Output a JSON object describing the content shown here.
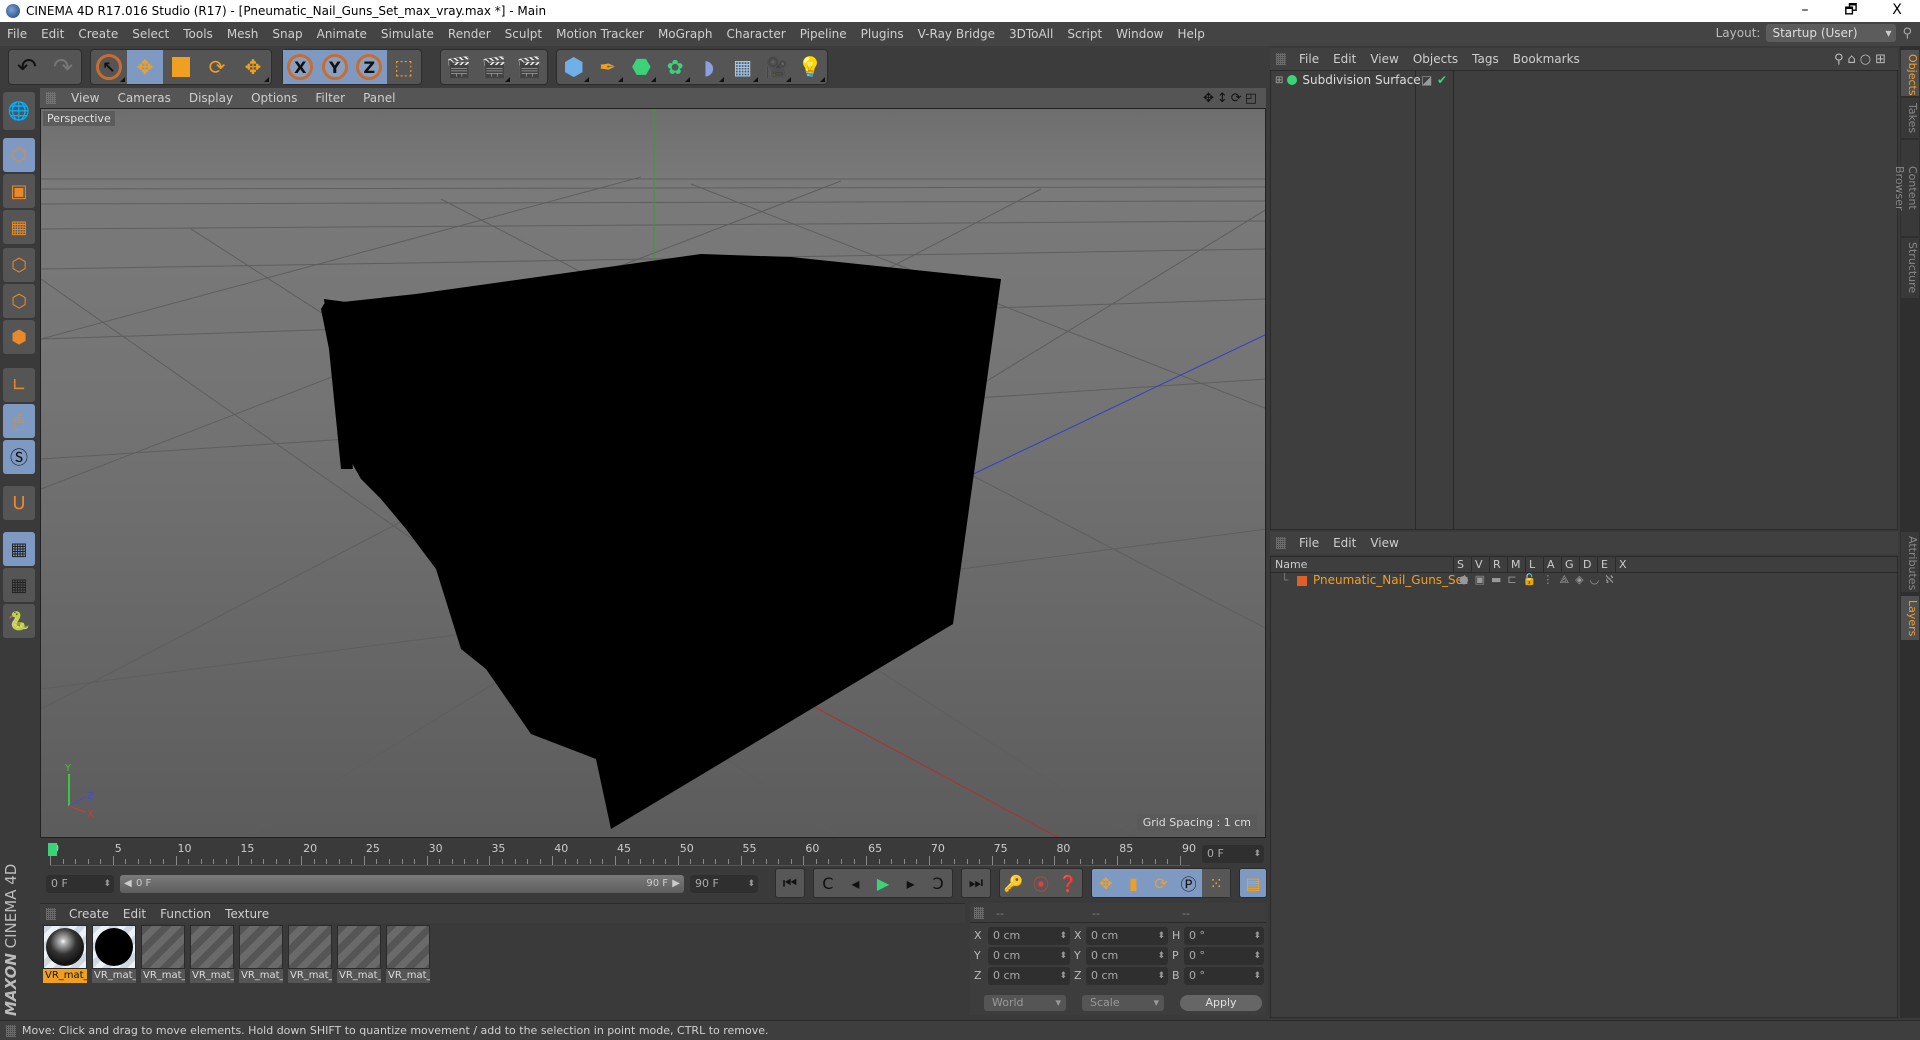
{
  "window": {
    "title": "CINEMA 4D R17.016 Studio (R17) - [Pneumatic_Nail_Guns_Set_max_vray.max *] - Main",
    "minimize": "–",
    "restore": "🗗",
    "close": "X"
  },
  "menubar": {
    "items": [
      "File",
      "Edit",
      "Create",
      "Select",
      "Tools",
      "Mesh",
      "Snap",
      "Animate",
      "Simulate",
      "Render",
      "Sculpt",
      "Motion Tracker",
      "MoGraph",
      "Character",
      "Pipeline",
      "Plugins",
      "V-Ray Bridge",
      "3DToAll",
      "Script",
      "Window",
      "Help"
    ],
    "layout_label": "Layout:",
    "layout_value": "Startup (User)"
  },
  "toolbar": {
    "undo": "↶",
    "redo": "↷",
    "x_axis": "X",
    "y_axis": "Y",
    "z_axis": "Z"
  },
  "viewport": {
    "menu": [
      "View",
      "Cameras",
      "Display",
      "Options",
      "Filter",
      "Panel"
    ],
    "camera_label": "Perspective",
    "grid_spacing": "Grid Spacing : 1 cm",
    "axis_labels": {
      "y": "Y",
      "z": "Z",
      "x": "X"
    }
  },
  "timeline": {
    "ticks": [
      "0",
      "5",
      "10",
      "15",
      "20",
      "25",
      "30",
      "35",
      "40",
      "45",
      "50",
      "55",
      "60",
      "65",
      "70",
      "75",
      "80",
      "85",
      "90"
    ],
    "current_frame": "0 F",
    "start_field": "0 F",
    "range_start": "0 F",
    "range_end": "90 F",
    "end_field": "90 F"
  },
  "materials": {
    "menu": [
      "Create",
      "Edit",
      "Function",
      "Texture"
    ],
    "items": [
      {
        "name": "VR_mat_",
        "type": "chrome",
        "selected": true
      },
      {
        "name": "VR_mat_",
        "type": "black",
        "selected": false
      },
      {
        "name": "VR_mat_",
        "type": "empty",
        "selected": false
      },
      {
        "name": "VR_mat_",
        "type": "empty",
        "selected": false
      },
      {
        "name": "VR_mat_",
        "type": "empty",
        "selected": false
      },
      {
        "name": "VR_mat_",
        "type": "empty",
        "selected": false
      },
      {
        "name": "VR_mat_",
        "type": "empty",
        "selected": false
      },
      {
        "name": "VR_mat_",
        "type": "empty",
        "selected": false
      }
    ]
  },
  "brand": {
    "maxon": "MAXON",
    "product": "CINEMA 4D"
  },
  "coordinates": {
    "headers": [
      "--",
      "--",
      "--"
    ],
    "rows": [
      {
        "a": "X",
        "av": "0 cm",
        "b": "X",
        "bv": "0 cm",
        "c": "H",
        "cv": "0 °"
      },
      {
        "a": "Y",
        "av": "0 cm",
        "b": "Y",
        "bv": "0 cm",
        "c": "P",
        "cv": "0 °"
      },
      {
        "a": "Z",
        "av": "0 cm",
        "b": "Z",
        "bv": "0 cm",
        "c": "B",
        "cv": "0 °"
      }
    ],
    "space": "World",
    "mode": "Scale",
    "apply": "Apply"
  },
  "objects_panel": {
    "menu": [
      "File",
      "Edit",
      "View",
      "Objects",
      "Tags",
      "Bookmarks"
    ],
    "items": [
      {
        "name": "Subdivision Surface"
      }
    ]
  },
  "layers_panel": {
    "menu": [
      "File",
      "Edit",
      "View"
    ],
    "columns": [
      "Name",
      "S",
      "V",
      "R",
      "M",
      "L",
      "A",
      "G",
      "D",
      "E",
      "X"
    ],
    "items": [
      {
        "name": "Pneumatic_Nail_Guns_Set",
        "color": "#e0602a"
      }
    ]
  },
  "side_tabs": {
    "top": [
      "Objects",
      "Takes",
      "Content Browser",
      "Structure"
    ],
    "bottom": [
      "Attributes",
      "Layers"
    ]
  },
  "status": {
    "text": "Move: Click and drag to move elements. Hold down SHIFT to quantize movement / add to the selection in point mode, CTRL to remove."
  },
  "colors": {
    "accent": "#f0a020",
    "selected_tool": "#7f9ac2",
    "layer_name": "#f0a020"
  }
}
